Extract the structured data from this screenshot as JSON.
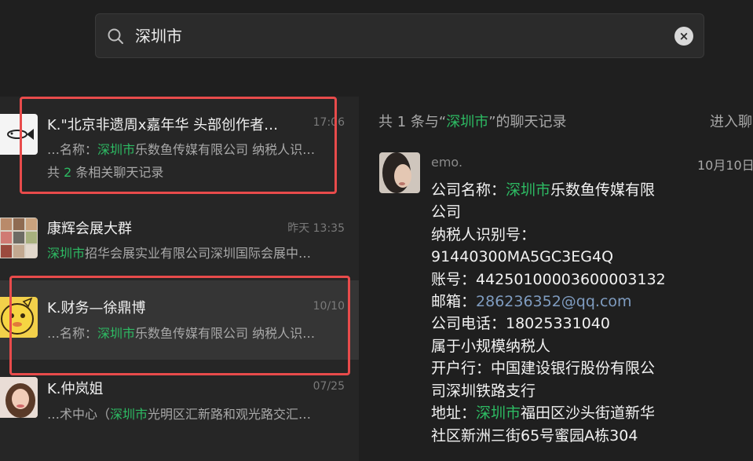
{
  "search": {
    "query": "深圳市"
  },
  "list": [
    {
      "title": "K.\"北京非遗周x嘉年华 头部创作者…",
      "time": "17:06",
      "snippet_pre": "…名称：",
      "snippet_hl": "深圳市",
      "snippet_post": "乐数鱼传媒有限公司 纳税人识…",
      "count_pre": "共 ",
      "count_num": "2",
      "count_post": " 条相关聊天记录"
    },
    {
      "title": "康辉会展大群",
      "time": "昨天 13:35",
      "snippet_pre": "",
      "snippet_hl": "深圳市",
      "snippet_post": "招华会展实业有限公司深圳国际会展中…"
    },
    {
      "title": "K.财务—徐鼎博",
      "time": "10/10",
      "snippet_pre": "…名称：",
      "snippet_hl": "深圳市",
      "snippet_post": "乐数鱼传媒有限公司 纳税人识…"
    },
    {
      "title": "K.仲岚姐",
      "time": "07/25",
      "snippet_pre": "…术中心（",
      "snippet_hl": "深圳市",
      "snippet_post": "光明区汇新路和观光路交汇…"
    }
  ],
  "right": {
    "header_pre": "共 1 条与“",
    "header_hl": "深圳市",
    "header_post": "”的聊天记录",
    "enter_label": "进入聊",
    "sender": "emo.",
    "time": "10月10日",
    "lines": {
      "l1_pre": "公司名称：",
      "l1_hl": "深圳市",
      "l1_post": "乐数鱼传媒有限",
      "l2": "公司",
      "l3": "纳税人识别号：",
      "l4": "91440300MA5GC3EG4Q",
      "l5": "账号：44250100003600003132",
      "l6_pre": "邮箱：",
      "l6_email": "286236352@qq.com",
      "l7": "公司电话：18025331040",
      "l8": "属于小规模纳税人",
      "l9": "开户行：中国建设银行股份有限公",
      "l10": "司深圳铁路支行",
      "l11_pre": "地址：",
      "l11_hl": "深圳市",
      "l11_post": "福田区沙头街道新华",
      "l12": "社区新洲三街65号蜜园A栋304"
    }
  },
  "colors": {
    "highlight": "#2dbb63",
    "annotation": "#e84b4b",
    "email": "#7f9cc0"
  }
}
